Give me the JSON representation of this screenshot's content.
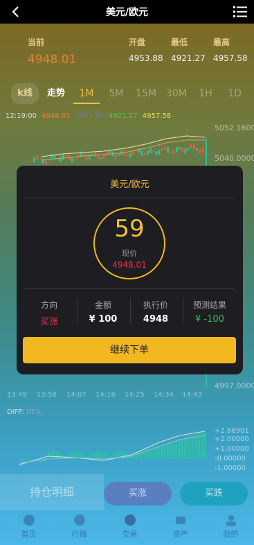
{
  "header": {
    "title": "美元/欧元"
  },
  "quote": {
    "current_label": "当前",
    "current_value": "4948.01",
    "open_label": "开盘",
    "open_value": "4953.88",
    "low_label": "最低",
    "low_value": "4921.27",
    "high_label": "最高",
    "high_value": "4957.58"
  },
  "tabs": [
    "k线",
    "走势",
    "1M",
    "5M",
    "15M",
    "30M",
    "1H",
    "1D"
  ],
  "active_tab": "1M",
  "pricebar": {
    "time": "12:19:00",
    "v1": "4948.01",
    "v2": "4953.88",
    "v3": "4921.27",
    "v4": "4957.58"
  },
  "chart_axis": {
    "y_labels": [
      "5052.1600",
      "5040.0000",
      "4997.0000"
    ],
    "x_labels": [
      "13:49",
      "13:58",
      "14:07",
      "14:16",
      "14:25",
      "14:34",
      "14:43"
    ]
  },
  "macd": {
    "diff_label": "DIFF:",
    "dea_label": "DEA:",
    "y_labels": [
      "+2.86901",
      "+2.00000",
      "+1.00000",
      "-0.00000",
      "-1.00000"
    ]
  },
  "modal": {
    "title": "美元/欧元",
    "countdown": "59",
    "price_label": "现价",
    "price_value": "4948.01",
    "cols": [
      {
        "head": "方向",
        "value": "买涨",
        "color": "#e8334a"
      },
      {
        "head": "金额",
        "value": "¥ 100",
        "color": "#ffffff"
      },
      {
        "head": "执行价",
        "value": "4948",
        "color": "#ffffff"
      },
      {
        "head": "预测结果",
        "value": "¥ -100",
        "color": "#2ec36a"
      }
    ],
    "button": "继续下单"
  },
  "actions": {
    "hold": "持仓明细",
    "rise": "买涨",
    "fall": "买跌"
  },
  "nav": [
    "首页",
    "行情",
    "交易",
    "资产",
    "我的"
  ],
  "colors": {
    "accent": "#f2c03d",
    "up": "#e8334a",
    "down": "#2ec36a"
  }
}
